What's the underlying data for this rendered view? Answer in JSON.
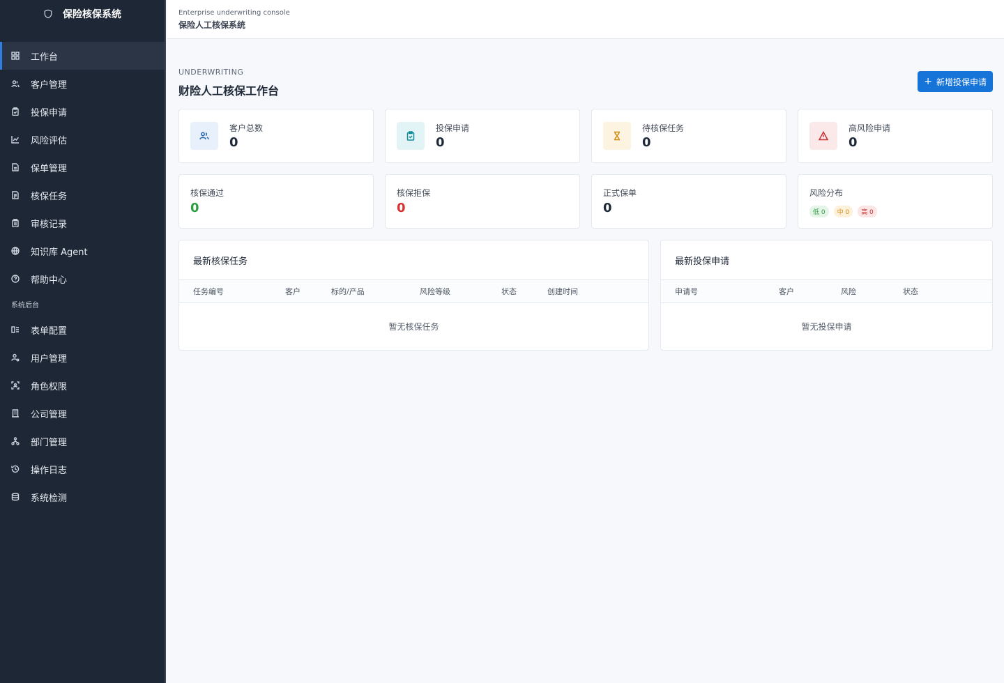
{
  "brand": {
    "title": "保险核保系统",
    "icon": "shield-icon"
  },
  "nav": [
    {
      "label": "工作台",
      "icon": "dashboard-icon",
      "active": true
    },
    {
      "label": "客户管理",
      "icon": "users-icon"
    },
    {
      "label": "投保申请",
      "icon": "clipboard-icon"
    },
    {
      "label": "风险评估",
      "icon": "chart-icon"
    },
    {
      "label": "保单管理",
      "icon": "document-icon"
    },
    {
      "label": "核保任务",
      "icon": "task-icon"
    },
    {
      "label": "审核记录",
      "icon": "record-icon"
    },
    {
      "label": "知识库 Agent",
      "icon": "globe-icon"
    },
    {
      "label": "帮助中心",
      "icon": "help-icon"
    }
  ],
  "nav_section": "系统后台",
  "nav_admin": [
    {
      "label": "表单配置",
      "icon": "form-icon"
    },
    {
      "label": "用户管理",
      "icon": "user-gear-icon"
    },
    {
      "label": "角色权限",
      "icon": "role-icon"
    },
    {
      "label": "公司管理",
      "icon": "building-icon"
    },
    {
      "label": "部门管理",
      "icon": "org-icon"
    },
    {
      "label": "操作日志",
      "icon": "history-icon"
    },
    {
      "label": "系统检测",
      "icon": "database-icon"
    }
  ],
  "topbar": {
    "subtitle": "Enterprise underwriting console",
    "title": "保险人工核保系统"
  },
  "page": {
    "eyebrow": "UNDERWRITING",
    "title": "财险人工核保工作台",
    "new_button": "新增投保申请"
  },
  "stats_row1": [
    {
      "label": "客户总数",
      "value": "0",
      "icon": "users-icon",
      "bg": "#e8f1fb",
      "color": "#2563a8"
    },
    {
      "label": "投保申请",
      "value": "0",
      "icon": "clipboard-icon",
      "bg": "#e3f4f6",
      "color": "#0e8a96"
    },
    {
      "label": "待核保任务",
      "value": "0",
      "icon": "hourglass-icon",
      "bg": "#fdf3e1",
      "color": "#d08a12"
    },
    {
      "label": "高风险申请",
      "value": "0",
      "icon": "warning-icon",
      "bg": "#fbe9e9",
      "color": "#c53030"
    }
  ],
  "stats_row2": {
    "approved": {
      "label": "核保通过",
      "value": "0",
      "color": "#2f9e44"
    },
    "rejected": {
      "label": "核保拒保",
      "value": "0",
      "color": "#d63031"
    },
    "policies": {
      "label": "正式保单",
      "value": "0",
      "color": "#1f2937"
    },
    "risk": {
      "label": "风险分布",
      "low": "低 0",
      "mid": "中 0",
      "high": "高 0"
    }
  },
  "tasks_panel": {
    "title": "最新核保任务",
    "columns": [
      "任务编号",
      "客户",
      "标的/产品",
      "风险等级",
      "状态",
      "创建时间"
    ],
    "empty": "暂无核保任务"
  },
  "apps_panel": {
    "title": "最新投保申请",
    "columns": [
      "申请号",
      "客户",
      "风险",
      "状态"
    ],
    "empty": "暂无投保申请"
  }
}
